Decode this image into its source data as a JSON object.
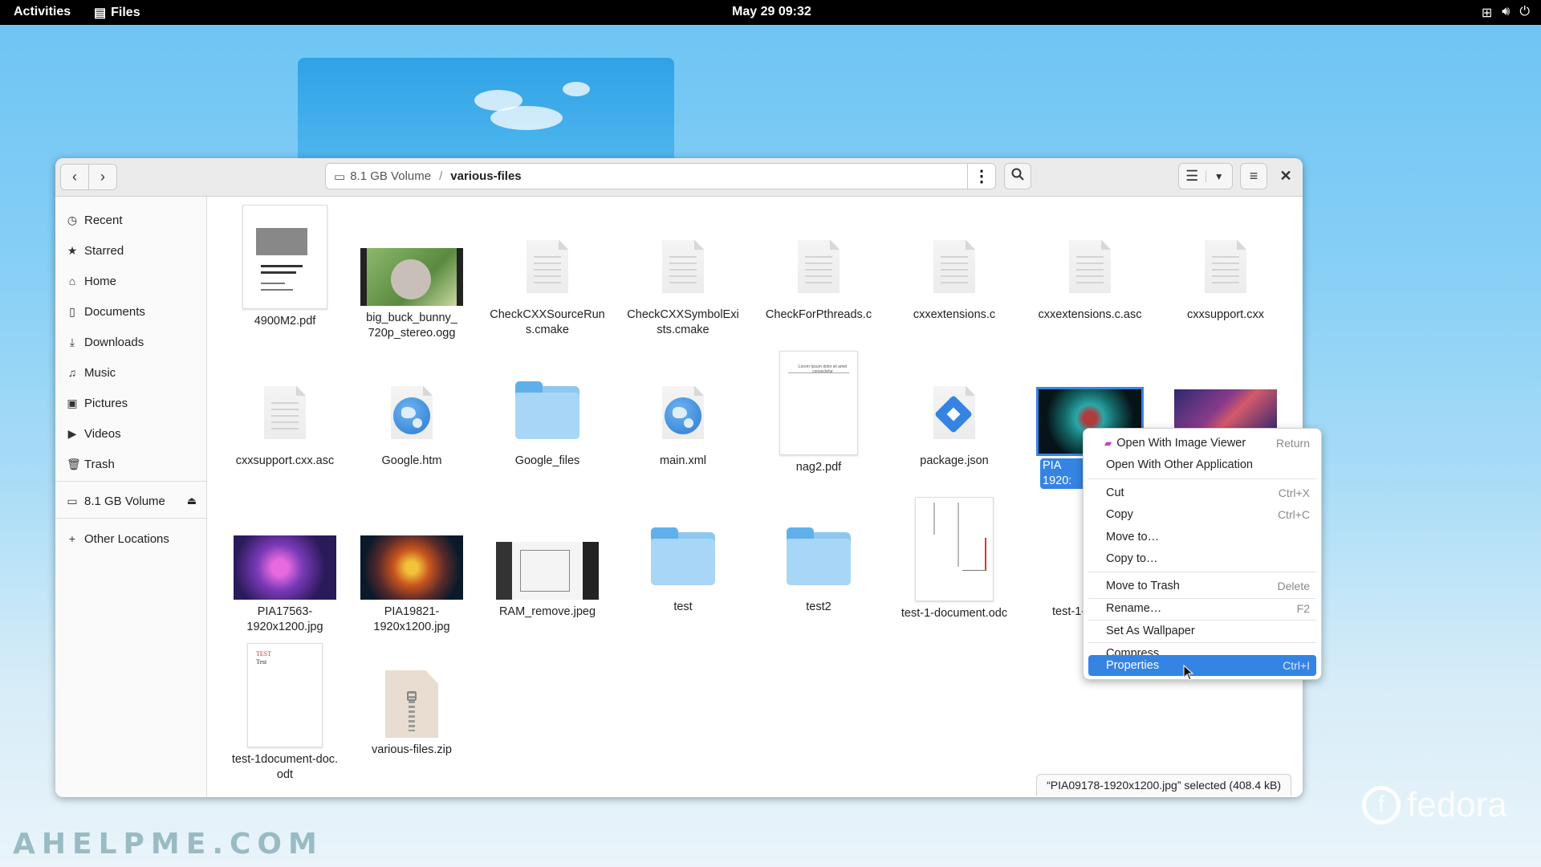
{
  "topbar": {
    "activities": "Activities",
    "app_name": "Files",
    "clock": "May 29  09:32"
  },
  "window": {
    "path": {
      "volume": "8.1 GB Volume",
      "folder": "various-files"
    }
  },
  "sidebar": {
    "items": [
      {
        "label": "Recent",
        "icon": "clock-icon"
      },
      {
        "label": "Starred",
        "icon": "star-icon"
      },
      {
        "label": "Home",
        "icon": "home-icon"
      },
      {
        "label": "Documents",
        "icon": "document-icon"
      },
      {
        "label": "Downloads",
        "icon": "download-icon"
      },
      {
        "label": "Music",
        "icon": "music-icon"
      },
      {
        "label": "Pictures",
        "icon": "pictures-icon"
      },
      {
        "label": "Videos",
        "icon": "video-icon"
      },
      {
        "label": "Trash",
        "icon": "trash-icon"
      }
    ],
    "volume": "8.1 GB Volume",
    "other_locations": "Other Locations"
  },
  "files": [
    {
      "name": "4900M2.pdf"
    },
    {
      "name": "big_buck_bunny_720p_stereo.ogg"
    },
    {
      "name": "CheckCXXSourceRuns.cmake"
    },
    {
      "name": "CheckCXXSymbolExists.cmake"
    },
    {
      "name": "CheckForPthreads.c"
    },
    {
      "name": "cxxextensions.c"
    },
    {
      "name": "cxxextensions.c.asc"
    },
    {
      "name": "cxxsupport.cxx"
    },
    {
      "name": "cxxsupport.cxx.asc"
    },
    {
      "name": "Google.htm"
    },
    {
      "name": "Google_files"
    },
    {
      "name": "main.xml"
    },
    {
      "name": "nag2.pdf"
    },
    {
      "name": "package.json"
    },
    {
      "name": "PIA09178-1920x1200.jpg",
      "visible": "PIA\n1920:"
    },
    {
      "name": "",
      "visible": ""
    },
    {
      "name": "PIA17563-1920x1200.jpg"
    },
    {
      "name": "PIA19821-1920x1200.jpg"
    },
    {
      "name": "RAM_remove.jpeg"
    },
    {
      "name": "test"
    },
    {
      "name": "test2"
    },
    {
      "name": "test-1-document.odc"
    },
    {
      "name": "test-1-d"
    },
    {
      "name": "test-1document-doc.odt"
    },
    {
      "name": "various-files.zip"
    }
  ],
  "labels": {
    "f0": "4900M2.pdf",
    "f1a": "big_buck_bunny_",
    "f1b": "720p_stereo.ogg",
    "f2a": "CheckCXXSourceRun",
    "f2b": "s.cmake",
    "f3a": "CheckCXXSymbolExi",
    "f3b": "sts.cmake",
    "f4": "CheckForPthreads.c",
    "f5": "cxxextensions.c",
    "f6": "cxxextensions.c.asc",
    "f7": "cxxsupport.cxx",
    "f8": "cxxsupport.cxx.asc",
    "f9": "Google.htm",
    "f10": "Google_files",
    "f11": "main.xml",
    "f12": "nag2.pdf",
    "f13": "package.json",
    "f14a": "PIA",
    "f14b": "1920:",
    "f16a": "PIA17563-",
    "f16b": "1920x1200.jpg",
    "f17a": "PIA19821-",
    "f17b": "1920x1200.jpg",
    "f18": "RAM_remove.jpeg",
    "f19": "test",
    "f20": "test2",
    "f21": "test-1-document.odc",
    "f22": "test-1-d",
    "f23a": "test-1document-doc.",
    "f23b": "odt",
    "f24": "various-files.zip",
    "nag2_text": "Lorem Ipsum dolor sit amet consectetur",
    "test_doc_text1": "TEST",
    "test_doc_text2": "Test"
  },
  "context_menu": {
    "items": [
      {
        "label": "Open With Image Viewer",
        "accel": "Return",
        "icon": "image-viewer-icon"
      },
      {
        "label": "Open With Other Application",
        "accel": ""
      },
      {
        "label": "Cut",
        "accel": "Ctrl+X"
      },
      {
        "label": "Copy",
        "accel": "Ctrl+C"
      },
      {
        "label": "Move to…",
        "accel": ""
      },
      {
        "label": "Copy to…",
        "accel": ""
      },
      {
        "label": "Move to Trash",
        "accel": "Delete"
      },
      {
        "label": "Rename…",
        "accel": "F2"
      },
      {
        "label": "Set As Wallpaper",
        "accel": ""
      },
      {
        "label": "Compress…",
        "accel": ""
      },
      {
        "label": "Properties",
        "accel": "Ctrl+I"
      }
    ]
  },
  "status": "“PIA09178-1920x1200.jpg” selected (408.4 kB)",
  "desktop": {
    "logo_text": "fedora",
    "watermark": "AHELPME.COM"
  },
  "colors": {
    "accent": "#3584e4",
    "topbar": "#000000"
  }
}
